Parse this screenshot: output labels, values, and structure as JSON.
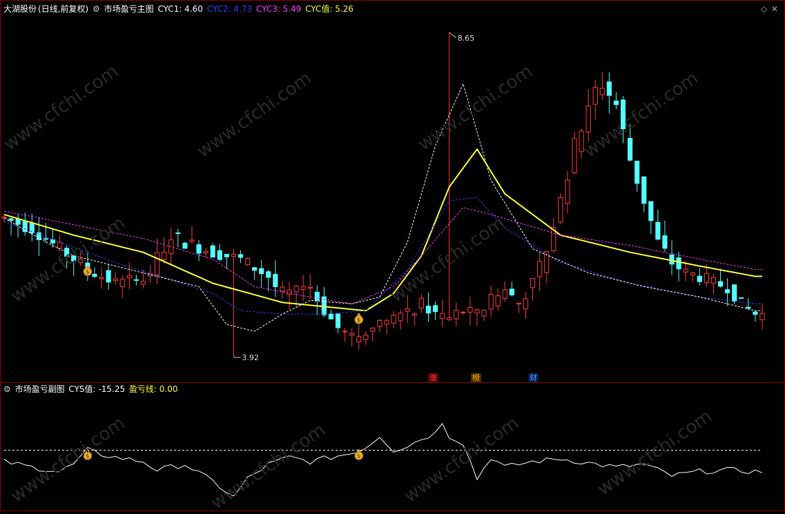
{
  "header": {
    "stock_name": "大湖股份",
    "period": "(日线,前复权)",
    "main_indicator": "市场盈亏主图",
    "items": [
      {
        "label": "CYC1: 4.60",
        "color": "#ffffff"
      },
      {
        "label": "CYC2: 4.73",
        "color": "#3a3aff"
      },
      {
        "label": "CYC3: 5.49",
        "color": "#ff3cff"
      },
      {
        "label": "CYC值: 5.26",
        "color": "#ffff3c"
      }
    ]
  },
  "sub_header": {
    "indicator": "市场盈亏副图",
    "items": [
      {
        "label": "CYS值: -15.25",
        "color": "#ffffff"
      },
      {
        "label": "盈亏线: 0.00",
        "color": "#ffff3c"
      }
    ]
  },
  "annotations": {
    "high": "8.65",
    "low": "3.92",
    "bottom_tags": [
      {
        "text": "涨",
        "color": "#ff4040",
        "bg": "#5a0000"
      },
      {
        "text": "榜",
        "color": "#ffb000",
        "bg": "#4a3000"
      },
      {
        "text": "财",
        "color": "#60a0ff",
        "bg": "#001a4a"
      }
    ]
  },
  "watermark": "www.cfchi.com",
  "colors": {
    "up": "#ff3c3c",
    "down": "#54ffff",
    "cyc_value": "#ffff3c",
    "cyc3": "#ff3cff",
    "cyc2": "#3a3aff",
    "cyc1": "#ffffff",
    "grid": "#8a0000"
  },
  "chart_data": [
    {
      "type": "candlestick",
      "title": "市场盈亏主图",
      "ylim": [
        3.7,
        8.9
      ],
      "x_count": 110,
      "price_path": [
        [
          0,
          5.95
        ],
        [
          4,
          5.8
        ],
        [
          8,
          5.5
        ],
        [
          12,
          5.2
        ],
        [
          16,
          5.0
        ],
        [
          20,
          5.05
        ],
        [
          22,
          5.35
        ],
        [
          24,
          5.7
        ],
        [
          26,
          5.6
        ],
        [
          30,
          5.45
        ],
        [
          34,
          5.35
        ],
        [
          38,
          5.1
        ],
        [
          40,
          4.8
        ],
        [
          42,
          4.9
        ],
        [
          44,
          4.95
        ],
        [
          46,
          4.6
        ],
        [
          48,
          4.35
        ],
        [
          50,
          4.2
        ],
        [
          52,
          4.3
        ],
        [
          54,
          4.45
        ],
        [
          56,
          4.5
        ],
        [
          58,
          4.55
        ],
        [
          60,
          4.7
        ],
        [
          62,
          4.55
        ],
        [
          64,
          4.5
        ],
        [
          66,
          4.6
        ],
        [
          68,
          4.55
        ],
        [
          70,
          4.75
        ],
        [
          72,
          4.9
        ],
        [
          74,
          4.7
        ],
        [
          76,
          5.0
        ],
        [
          78,
          5.5
        ],
        [
          80,
          6.2
        ],
        [
          82,
          7.0
        ],
        [
          84,
          7.6
        ],
        [
          86,
          7.9
        ],
        [
          88,
          7.6
        ],
        [
          90,
          6.8
        ],
        [
          92,
          6.2
        ],
        [
          94,
          5.6
        ],
        [
          96,
          5.3
        ],
        [
          98,
          5.15
        ],
        [
          100,
          5.1
        ],
        [
          102,
          5.0
        ],
        [
          104,
          4.95
        ],
        [
          106,
          4.7
        ],
        [
          108,
          4.55
        ],
        [
          110,
          4.55
        ]
      ],
      "high_point": {
        "x": 64,
        "y": 8.65,
        "label": "8.65"
      },
      "low_point": {
        "x": 33,
        "y": 3.92,
        "label": "3.92"
      },
      "series": [
        {
          "name": "CYC值",
          "color": "#ffff3c",
          "values": [
            [
              0,
              6.0
            ],
            [
              10,
              5.7
            ],
            [
              20,
              5.45
            ],
            [
              30,
              5.0
            ],
            [
              40,
              4.72
            ],
            [
              50,
              4.62
            ],
            [
              52,
              4.6
            ],
            [
              56,
              4.85
            ],
            [
              60,
              5.4
            ],
            [
              64,
              6.4
            ],
            [
              68,
              6.95
            ],
            [
              72,
              6.3
            ],
            [
              80,
              5.7
            ],
            [
              90,
              5.45
            ],
            [
              100,
              5.25
            ],
            [
              108,
              5.1
            ]
          ]
        },
        {
          "name": "CYC3",
          "color": "#ff3cff",
          "values": [
            [
              0,
              6.05
            ],
            [
              10,
              5.85
            ],
            [
              20,
              5.65
            ],
            [
              30,
              5.35
            ],
            [
              36,
              4.95
            ],
            [
              44,
              4.8
            ],
            [
              50,
              4.7
            ],
            [
              56,
              4.95
            ],
            [
              60,
              5.4
            ],
            [
              66,
              6.1
            ],
            [
              70,
              6.0
            ],
            [
              80,
              5.7
            ],
            [
              90,
              5.55
            ],
            [
              100,
              5.35
            ],
            [
              108,
              5.2
            ]
          ]
        },
        {
          "name": "CYC2",
          "color": "#3a3aff",
          "values": [
            [
              0,
              5.9
            ],
            [
              8,
              5.6
            ],
            [
              16,
              5.3
            ],
            [
              24,
              5.05
            ],
            [
              30,
              4.85
            ],
            [
              34,
              4.6
            ],
            [
              40,
              4.55
            ],
            [
              46,
              4.55
            ],
            [
              52,
              4.6
            ],
            [
              58,
              5.2
            ],
            [
              64,
              6.2
            ],
            [
              68,
              6.25
            ],
            [
              72,
              5.8
            ],
            [
              80,
              5.3
            ],
            [
              90,
              5.0
            ],
            [
              100,
              4.8
            ],
            [
              108,
              4.7
            ]
          ]
        },
        {
          "name": "CYC1",
          "color": "#ffffff",
          "values": [
            [
              0,
              5.95
            ],
            [
              6,
              5.6
            ],
            [
              10,
              5.4
            ],
            [
              16,
              5.25
            ],
            [
              22,
              5.1
            ],
            [
              28,
              4.95
            ],
            [
              32,
              4.4
            ],
            [
              36,
              4.3
            ],
            [
              40,
              4.55
            ],
            [
              44,
              4.75
            ],
            [
              50,
              4.7
            ],
            [
              54,
              4.8
            ],
            [
              58,
              5.6
            ],
            [
              62,
              7.0
            ],
            [
              66,
              7.9
            ],
            [
              70,
              6.5
            ],
            [
              76,
              5.5
            ],
            [
              84,
              5.15
            ],
            [
              92,
              4.95
            ],
            [
              100,
              4.8
            ],
            [
              108,
              4.6
            ]
          ]
        }
      ],
      "signal_markers": [
        {
          "x": 12,
          "y": 5.25
        },
        {
          "x": 51,
          "y": 4.55
        }
      ]
    },
    {
      "type": "line",
      "title": "市场盈亏副图",
      "ylim": [
        -40,
        40
      ],
      "reference_line": 0,
      "series": [
        {
          "name": "CYS值",
          "color": "#ffffff",
          "values": [
            [
              0,
              -8
            ],
            [
              4,
              -12
            ],
            [
              8,
              -15
            ],
            [
              10,
              -10
            ],
            [
              12,
              0
            ],
            [
              14,
              -3
            ],
            [
              16,
              -5
            ],
            [
              20,
              -8
            ],
            [
              22,
              -14
            ],
            [
              26,
              -10
            ],
            [
              30,
              -22
            ],
            [
              33,
              -33
            ],
            [
              35,
              -20
            ],
            [
              38,
              -10
            ],
            [
              41,
              -5
            ],
            [
              44,
              -8
            ],
            [
              48,
              -4
            ],
            [
              50,
              -2
            ],
            [
              52,
              2
            ],
            [
              54,
              10
            ],
            [
              56,
              0
            ],
            [
              58,
              3
            ],
            [
              60,
              8
            ],
            [
              62,
              12
            ],
            [
              63,
              20
            ],
            [
              64,
              10
            ],
            [
              66,
              5
            ],
            [
              68,
              -20
            ],
            [
              70,
              -5
            ],
            [
              72,
              -12
            ],
            [
              76,
              -8
            ],
            [
              80,
              -6
            ],
            [
              84,
              -9
            ],
            [
              88,
              -12
            ],
            [
              92,
              -10
            ],
            [
              96,
              -18
            ],
            [
              100,
              -15
            ],
            [
              104,
              -14
            ],
            [
              108,
              -15
            ]
          ]
        }
      ],
      "signal_markers": [
        {
          "x": 12,
          "y": 0
        },
        {
          "x": 51,
          "y": 0
        }
      ]
    }
  ]
}
